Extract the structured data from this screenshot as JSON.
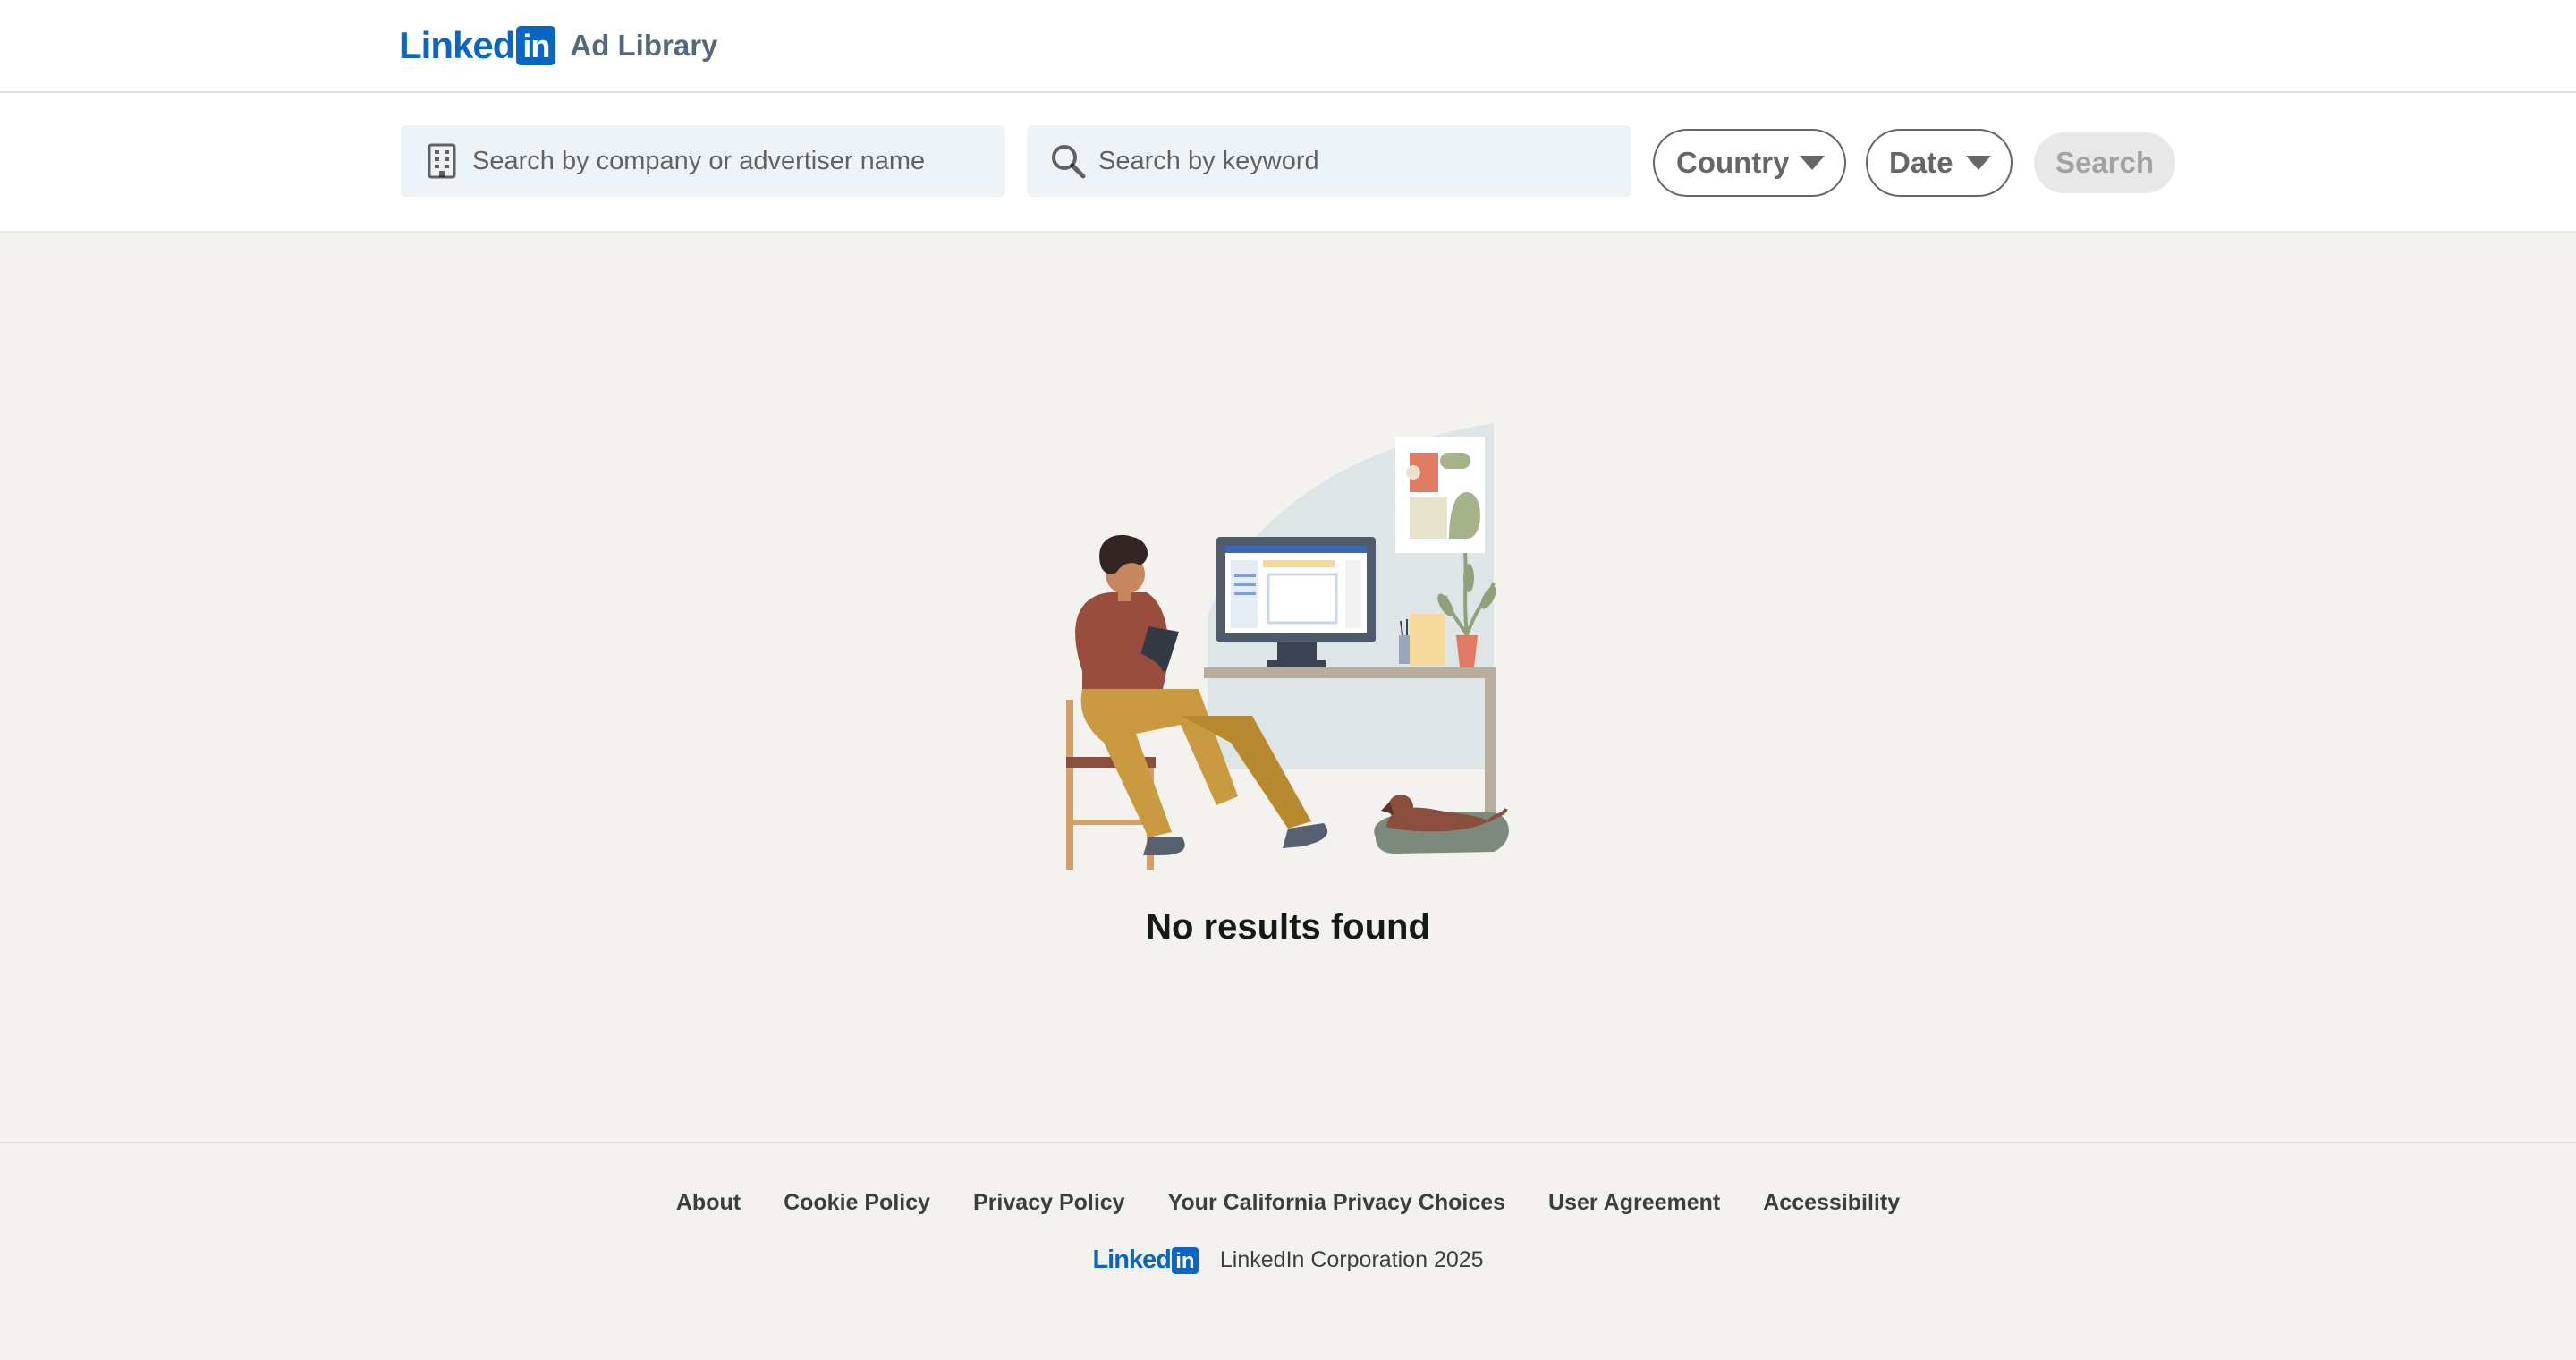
{
  "header": {
    "logo_word": "Linked",
    "logo_box": "in",
    "product_name": "Ad Library"
  },
  "search": {
    "company_placeholder": "Search by company or advertiser name",
    "company_value": "",
    "company_icon": "building-icon",
    "keyword_placeholder": "Search by keyword",
    "keyword_value": "",
    "keyword_icon": "search-icon",
    "country_label": "Country",
    "date_label": "Date",
    "search_button_label": "Search"
  },
  "results": {
    "empty_message": "No results found"
  },
  "footer": {
    "links": [
      "About",
      "Cookie Policy",
      "Privacy Policy",
      "Your California Privacy Choices",
      "User Agreement",
      "Accessibility"
    ],
    "logo_word": "Linked",
    "logo_box": "in",
    "copyright": "LinkedIn Corporation 2025"
  },
  "colors": {
    "brand": "#0a66c2",
    "page_bg": "#f3f2ef",
    "field_bg": "#eef3f8"
  }
}
